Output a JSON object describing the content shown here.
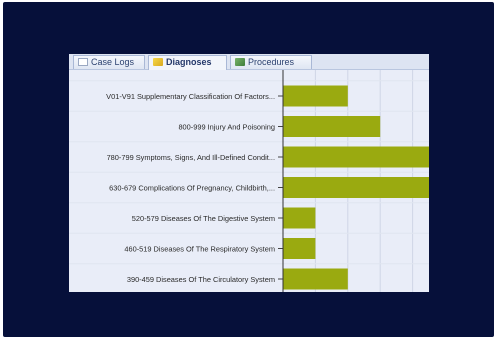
{
  "tabs": [
    {
      "label": "Case Logs",
      "icon": "case-logs-icon",
      "active": false
    },
    {
      "label": "Diagnoses",
      "icon": "diagnoses-icon",
      "active": true
    },
    {
      "label": "Procedures",
      "icon": "procedures-icon",
      "active": false
    }
  ],
  "colors": {
    "bar": "#9aaa10",
    "background": "#06103a",
    "panel": "#e9edf8"
  },
  "chart_data": {
    "type": "bar",
    "orientation": "horizontal",
    "categories": [
      "V01-V91 Supplementary Classification Of Factors...",
      "800-999 Injury And Poisoning",
      "780-799 Symptoms, Signs, And Ill-Defined Condit...",
      "630-679 Complications Of Pregnancy, Childbirth,...",
      "520-579 Diseases Of The Digestive System",
      "460-519 Diseases Of The Respiratory System",
      "390-459 Diseases Of The Circulatory System"
    ],
    "values": [
      2,
      3,
      5,
      5,
      1,
      1,
      2
    ],
    "xlim": [
      0,
      4.5
    ],
    "grid": true,
    "title": "",
    "xlabel": "",
    "ylabel": ""
  }
}
